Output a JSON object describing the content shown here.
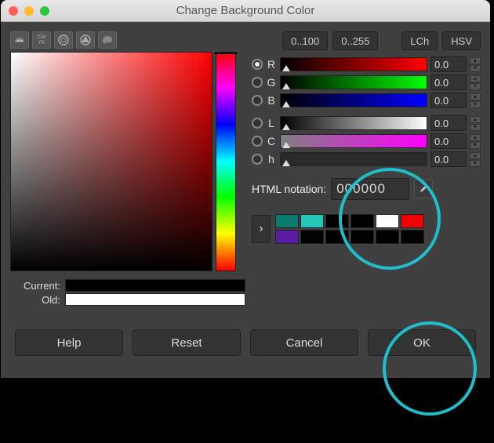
{
  "window": {
    "title": "Change Background Color"
  },
  "tabs": {
    "gimp": "gimp-icon",
    "cmyk": "CMYK",
    "watercolor": "watercolor-icon",
    "triangle": "triangle-icon",
    "palette": "palette-icon"
  },
  "ranges": {
    "r0_100": "0..100",
    "r0_255": "0..255",
    "lch": "LCh",
    "hsv": "HSV"
  },
  "channels": {
    "r": {
      "label": "R",
      "value": "0.0",
      "gradient": "linear-gradient(to right,#000,#f00)"
    },
    "g": {
      "label": "G",
      "value": "0.0",
      "gradient": "linear-gradient(to right,#000,#0f0)"
    },
    "b": {
      "label": "B",
      "value": "0.0",
      "gradient": "linear-gradient(to right,#000,#00f)"
    },
    "l": {
      "label": "L",
      "value": "0.0",
      "gradient": "linear-gradient(to right,#000,#fff)"
    },
    "c": {
      "label": "C",
      "value": "0.0",
      "gradient": "linear-gradient(to right,#808080,#f0f)"
    },
    "h": {
      "label": "h",
      "value": "0.0",
      "gradient": "#333"
    }
  },
  "html_notation": {
    "label": "HTML notation:",
    "value": "000000"
  },
  "current_old": {
    "current_label": "Current:",
    "old_label": "Old:"
  },
  "swatches": {
    "row1": [
      "#0a7a6f",
      "#23c7b7",
      "#000000",
      "#000000",
      "#ffffff",
      "#f00000"
    ],
    "row2": [
      "#5a1da4",
      "#000000",
      "#000000",
      "#000000",
      "#000000",
      "#000000"
    ]
  },
  "buttons": {
    "help": "Help",
    "reset": "Reset",
    "cancel": "Cancel",
    "ok": "OK"
  }
}
